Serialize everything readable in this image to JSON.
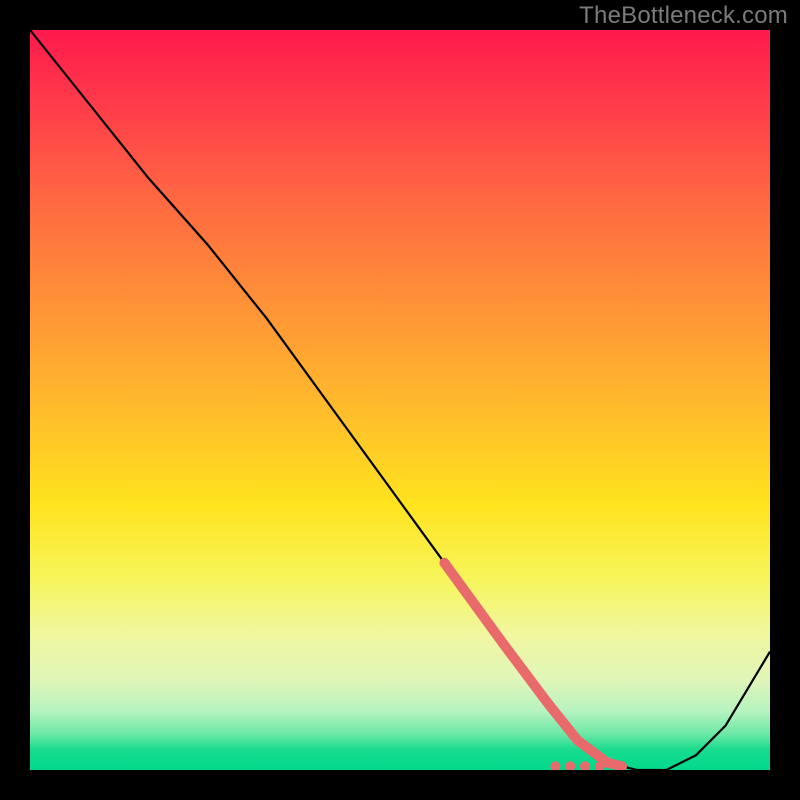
{
  "watermark": "TheBottleneck.com",
  "chart_data": {
    "type": "line",
    "title": "",
    "xlabel": "",
    "ylabel": "",
    "xlim": [
      0,
      100
    ],
    "ylim": [
      0,
      100
    ],
    "series": [
      {
        "name": "curve",
        "x": [
          0,
          8,
          16,
          24,
          32,
          40,
          48,
          56,
          64,
          70,
          74,
          78,
          82,
          86,
          90,
          94,
          100
        ],
        "y": [
          100,
          90,
          80,
          71,
          61,
          50,
          39,
          28,
          17,
          9,
          4,
          1,
          0,
          0,
          2,
          6,
          16
        ]
      }
    ],
    "highlight_segment": {
      "name": "optimal-range",
      "x": [
        56,
        64,
        70,
        74,
        78,
        80
      ],
      "y": [
        28,
        17,
        9,
        4,
        1,
        0.5
      ]
    },
    "highlight_dots": {
      "x": [
        71,
        73,
        75,
        77,
        80
      ],
      "y": [
        0.5,
        0.5,
        0.5,
        0.5,
        0.5
      ]
    },
    "gradient_stops": [
      {
        "pos": 0,
        "color": "#ff1a4d"
      },
      {
        "pos": 50,
        "color": "#ffb82d"
      },
      {
        "pos": 74,
        "color": "#f7f55a"
      },
      {
        "pos": 100,
        "color": "#00d98c"
      }
    ]
  }
}
